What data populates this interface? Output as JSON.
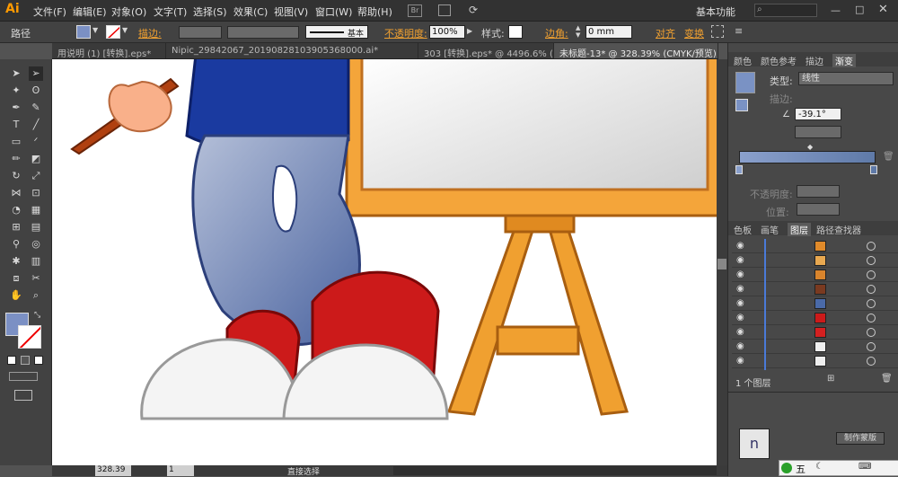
{
  "app": {
    "logo": "Ai"
  },
  "menus": [
    "文件(F)",
    "编辑(E)",
    "对象(O)",
    "文字(T)",
    "选择(S)",
    "效果(C)",
    "视图(V)",
    "窗口(W)",
    "帮助(H)"
  ],
  "workspace": {
    "label": "基本功能",
    "search_placeholder": ""
  },
  "control": {
    "selection_label": "路径",
    "stroke_label": "描边:",
    "stroke_style": "基本",
    "opacity_label": "不透明度:",
    "opacity_value": "100%",
    "style_label": "样式:",
    "corner_label": "边角:",
    "corner_value": "0 mm",
    "align_label": "对齐",
    "transform_label": "变换"
  },
  "tabs": [
    {
      "label": "用说明 (1) [转换].eps*"
    },
    {
      "label": "Nipic_29842067_20190828103905368000.ai*"
    },
    {
      "label": "303 [转换].eps* @ 4496.6% (RG..."
    },
    {
      "label": "未标题-13* @ 328.39% (CMYK/预览)",
      "active": true
    }
  ],
  "tools": [
    "selection",
    "direct-selection",
    "magic-wand",
    "lasso",
    "pen",
    "curvature",
    "type",
    "line",
    "rectangle",
    "paintbrush",
    "pencil",
    "eraser",
    "rotate",
    "scale",
    "width",
    "free-transform",
    "shape-builder",
    "perspective",
    "mesh",
    "gradient",
    "eyedropper",
    "blend",
    "symbol-sprayer",
    "column-graph",
    "artboard",
    "slice",
    "hand",
    "zoom"
  ],
  "gradient_panel": {
    "tabs": [
      "颜色",
      "颜色参考",
      "描边",
      "渐变"
    ],
    "active_tab": "渐变",
    "type_label": "类型:",
    "type_value": "线性",
    "stroke_label": "描边:",
    "angle_value": "-39.1°",
    "opacity_label": "不透明度:",
    "location_label": "位置:",
    "start_color": "#8aa0cc",
    "end_color": "#5f7aa8"
  },
  "layers_panel": {
    "tabs": [
      "色板",
      "画笔",
      "图层",
      "路径查找器"
    ],
    "active_tab": "图层",
    "rows": [
      {
        "color": "#e08a2a"
      },
      {
        "color": "#e8a850"
      },
      {
        "color": "#d9842c"
      },
      {
        "color": "#7a3a20"
      },
      {
        "color": "#4a6aa8"
      },
      {
        "color": "#cc1a1a"
      },
      {
        "color": "#d42020"
      },
      {
        "color": "#f0f0f0"
      },
      {
        "color": "#eeeeee"
      }
    ],
    "footer_label": "1 个图层",
    "button_make_mask": "制作蒙版"
  },
  "status": {
    "zoom": "328.39",
    "page": "1",
    "tool_name": "直接选择"
  },
  "taskbar": {
    "ime": "五"
  }
}
